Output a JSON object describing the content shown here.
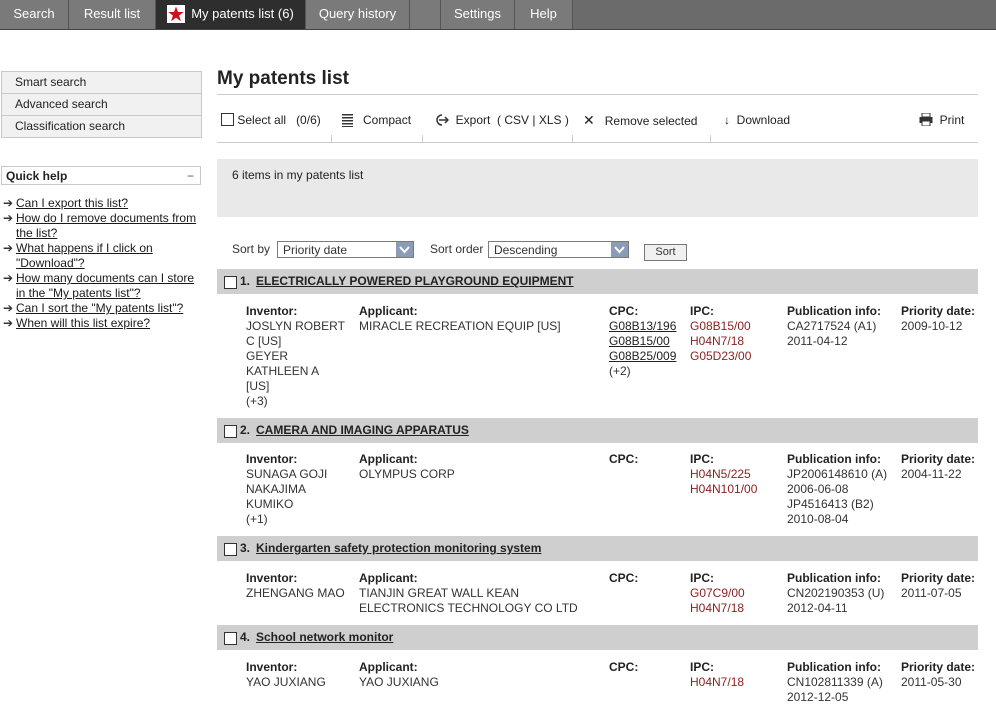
{
  "tabs": [
    {
      "label": "Search"
    },
    {
      "label": "Result list"
    },
    {
      "label": "My patents list (6)"
    },
    {
      "label": "Query history"
    },
    {
      "label": ""
    },
    {
      "label": "Settings"
    },
    {
      "label": "Help"
    }
  ],
  "sidebar": {
    "items": [
      {
        "label": "Smart search"
      },
      {
        "label": "Advanced search"
      },
      {
        "label": "Classification search"
      }
    ],
    "quick_help": {
      "title": "Quick help",
      "collapse": "−",
      "links": [
        {
          "label": "Can I export this list?"
        },
        {
          "label": "How do I remove documents from the list?"
        },
        {
          "label": "What happens if I click on \"Download\"?"
        },
        {
          "label": "How many documents can I store in the \"My patents list\"?"
        },
        {
          "label": "Can I sort the \"My patents list\"?"
        },
        {
          "label": "When will this list expire?"
        }
      ]
    }
  },
  "main": {
    "title": "My patents list",
    "toolbar": {
      "select_all": "Select all",
      "select_count": "(0/6)",
      "compact": "Compact",
      "export": "Export",
      "export_formats": "( CSV | XLS )",
      "remove": "Remove selected",
      "download": "Download",
      "print": "Print"
    },
    "info": "6 items in my patents list",
    "sort": {
      "sort_by_label": "Sort by",
      "sort_by_value": "Priority date",
      "order_label": "Sort order",
      "order_value": "Descending",
      "button": "Sort"
    }
  },
  "labels": {
    "inventor": "Inventor:",
    "applicant": "Applicant:",
    "cpc": "CPC:",
    "ipc": "IPC:",
    "publication": "Publication info:",
    "priority": "Priority date:"
  },
  "results": [
    {
      "num": "1.",
      "title": "ELECTRICALLY POWERED PLAYGROUND EQUIPMENT",
      "inventor": [
        "JOSLYN ROBERT",
        "C  [US]",
        "GEYER",
        "KATHLEEN A",
        "[US]",
        "(+3)"
      ],
      "applicant": [
        "MIRACLE RECREATION EQUIP  [US]"
      ],
      "cpc": [
        "G08B13/196",
        "G08B15/00",
        "G08B25/009"
      ],
      "cpc_more": "(+2)",
      "ipc": [
        "G08B15/00",
        "H04N7/18",
        "G05D23/00"
      ],
      "publication": [
        "CA2717524 (A1)",
        "2011-04-12"
      ],
      "priority": "2009-10-12"
    },
    {
      "num": "2.",
      "title": "CAMERA AND IMAGING APPARATUS",
      "inventor": [
        "SUNAGA GOJI",
        "NAKAJIMA",
        "KUMIKO",
        "(+1)"
      ],
      "applicant": [
        "OLYMPUS CORP"
      ],
      "cpc": [],
      "cpc_more": "",
      "ipc": [
        "H04N5/225",
        "H04N101/00"
      ],
      "publication": [
        "JP2006148610 (A)",
        "2006-06-08",
        "JP4516413 (B2)",
        "2010-08-04"
      ],
      "priority": "2004-11-22"
    },
    {
      "num": "3.",
      "title": "Kindergarten safety protection monitoring system",
      "inventor": [
        "ZHENGANG MAO"
      ],
      "applicant": [
        "TIANJIN GREAT WALL KEAN",
        "ELECTRONICS TECHNOLOGY CO LTD"
      ],
      "cpc": [],
      "cpc_more": "",
      "ipc": [
        "G07C9/00",
        "H04N7/18"
      ],
      "publication": [
        "CN202190353 (U)",
        "2012-04-11"
      ],
      "priority": "2011-07-05"
    },
    {
      "num": "4.",
      "title": "School network monitor",
      "inventor": [
        "YAO JUXIANG"
      ],
      "applicant": [
        "YAO JUXIANG"
      ],
      "cpc": [],
      "cpc_more": "",
      "ipc": [
        "H04N7/18"
      ],
      "publication": [
        "CN102811339 (A)",
        "2012-12-05"
      ],
      "priority": "2011-05-30"
    }
  ]
}
